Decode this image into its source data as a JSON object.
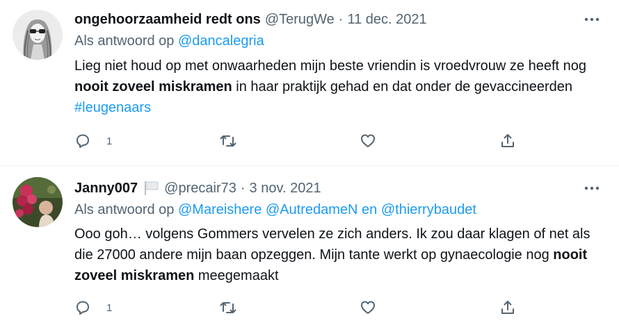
{
  "tweets": [
    {
      "author_name": "ongehoorzaamheid redt ons",
      "handle": "@TerugWe",
      "separator": "·",
      "date": "11 dec. 2021",
      "reply_prefix": "Als antwoord op",
      "reply_mentions": [
        "@dancalegria"
      ],
      "body": {
        "t1": "Lieg niet houd op met onwaarheden mijn beste vriendin is vroedvrouw ze heeft nog ",
        "bold": "nooit zoveel miskramen",
        "t2": " in haar praktijk gehad en dat onder de gevaccineerden ",
        "hashtag": "#leugenaars"
      },
      "reply_count": "1",
      "retweet_count": "",
      "like_count": ""
    },
    {
      "author_name": "Janny007",
      "handle": "@precair73",
      "separator": "·",
      "date": "3 nov. 2021",
      "reply_prefix": "Als antwoord op",
      "reply_mentions": [
        "@Mareishere",
        "@AutredameN"
      ],
      "reply_conj": "en",
      "reply_mention_last": "@thierrybaudet",
      "body": {
        "t1": "Ooo goh… volgens Gommers vervelen ze zich anders. Ik zou daar klagen of net als die 27000 andere mijn baan opzeggen. Mijn tante werkt op gynaecologie nog ",
        "bold": "nooit zoveel miskramen",
        "t2": " meegemaakt"
      },
      "reply_count": "1",
      "retweet_count": "",
      "like_count": ""
    }
  ],
  "icons": {
    "reply": "reply-icon",
    "retweet": "retweet-icon",
    "like": "heart-icon",
    "share": "share-icon",
    "more": "more-icon",
    "flag": "white-flag-icon"
  },
  "colors": {
    "text": "#0f1419",
    "secondary": "#536471",
    "link": "#1d9bf0",
    "divider": "#eff3f4"
  }
}
